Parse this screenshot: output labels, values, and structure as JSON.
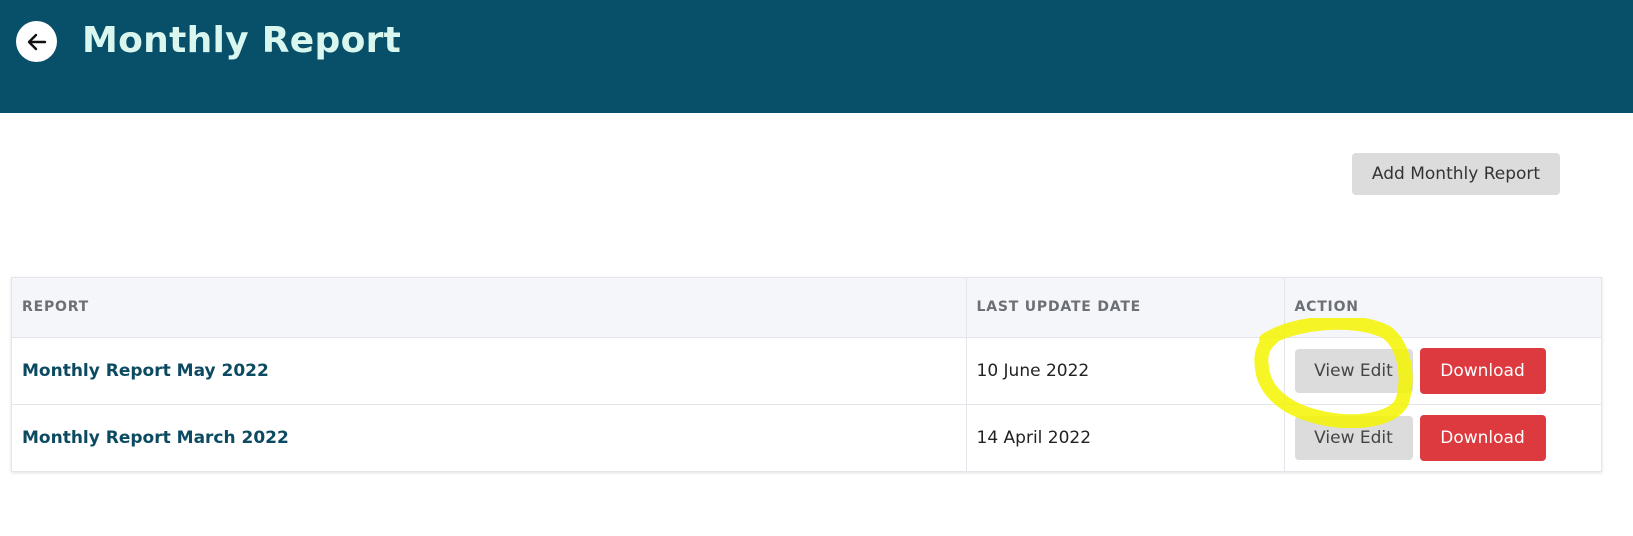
{
  "header": {
    "title": "Monthly Report",
    "back_icon": "arrow-left-icon",
    "background_color": "#084f6a",
    "title_color": "#d9f7ef"
  },
  "toolbar": {
    "add_label": "Add Monthly Report"
  },
  "table": {
    "columns": [
      "REPORT",
      "LAST UPDATE DATE",
      "ACTION"
    ],
    "rows": [
      {
        "report": "Monthly Report May 2022",
        "date": "10 June 2022",
        "view_label": "View Edit",
        "download_label": "Download"
      },
      {
        "report": "Monthly Report March 2022",
        "date": "14 April 2022",
        "view_label": "View Edit",
        "download_label": "Download"
      }
    ]
  },
  "colors": {
    "download": "#dc3a3f",
    "highlight_annotation": "#ffff00"
  }
}
